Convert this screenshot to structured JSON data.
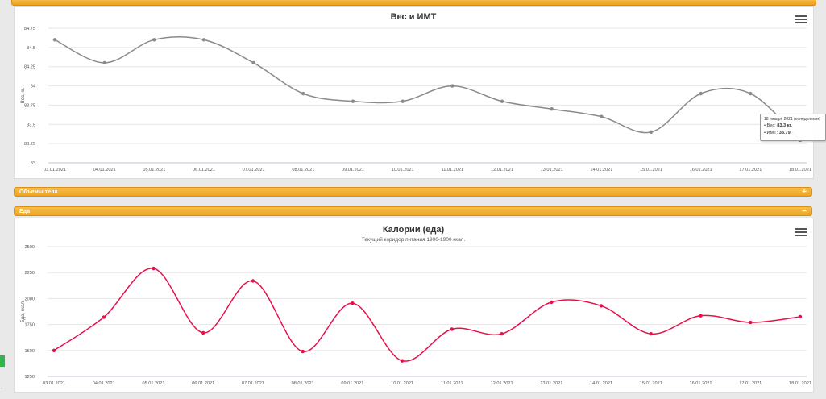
{
  "colors": {
    "weight_series": "#8a8a8a",
    "calorie_series": "#e8104a",
    "panel_orange": "#eda11d",
    "grid": "#e6e6e6"
  },
  "panels": {
    "volumes": {
      "label": "Объемы тела",
      "toggle": "+"
    },
    "food": {
      "label": "Еда",
      "toggle": "−"
    }
  },
  "menu_icon": "hamburger-menu-icon",
  "tooltip": {
    "date": "18 января 2021 (понедельник)",
    "weight_prefix": "• Вес: ",
    "weight_value": "83.3 кг.",
    "bmi_prefix": "• ИМТ: ",
    "bmi_value": "33.79"
  },
  "chart_data": [
    {
      "type": "line",
      "title": "Вес и ИМТ",
      "subtitle": "",
      "xlabel": "",
      "ylabel": "Вес, кг.",
      "categories": [
        "03.01.2021",
        "04.01.2021",
        "05.01.2021",
        "06.01.2021",
        "07.01.2021",
        "08.01.2021",
        "09.01.2021",
        "10.01.2021",
        "11.01.2021",
        "12.01.2021",
        "13.01.2021",
        "14.01.2021",
        "15.01.2021",
        "16.01.2021",
        "17.01.2021",
        "18.01.2021"
      ],
      "series": [
        {
          "values": [
            84.6,
            84.3,
            84.6,
            84.6,
            84.3,
            83.9,
            83.8,
            83.8,
            84.0,
            83.8,
            83.7,
            83.6,
            83.4,
            83.9,
            83.9,
            83.3
          ]
        }
      ],
      "ylim": [
        83,
        84.75
      ],
      "yticks": [
        "83",
        "83.25",
        "83.5",
        "83.75",
        "84",
        "84.25",
        "84.5",
        "84.75"
      ],
      "grid": true,
      "highlighted_index": 15
    },
    {
      "type": "line",
      "title": "Калории (еда)",
      "subtitle": "Текущий коридор питания 1900-1900 ккал.",
      "xlabel": "",
      "ylabel": "Еда, ккал.",
      "categories": [
        "03.01.2021",
        "04.01.2021",
        "05.01.2021",
        "06.01.2021",
        "07.01.2021",
        "08.01.2021",
        "09.01.2021",
        "10.01.2021",
        "11.01.2021",
        "12.01.2021",
        "13.01.2021",
        "14.01.2021",
        "15.01.2021",
        "16.01.2021",
        "17.01.2021",
        "18.01.2021"
      ],
      "series": [
        {
          "values": [
            1500,
            1820,
            2290,
            1670,
            2170,
            1490,
            1955,
            1400,
            1705,
            1660,
            1965,
            1930,
            1660,
            1835,
            1770,
            1825
          ]
        }
      ],
      "ylim": [
        1250,
        2500
      ],
      "yticks": [
        "1250",
        "1500",
        "1750",
        "2000",
        "2250",
        "2500"
      ],
      "grid": true
    }
  ]
}
